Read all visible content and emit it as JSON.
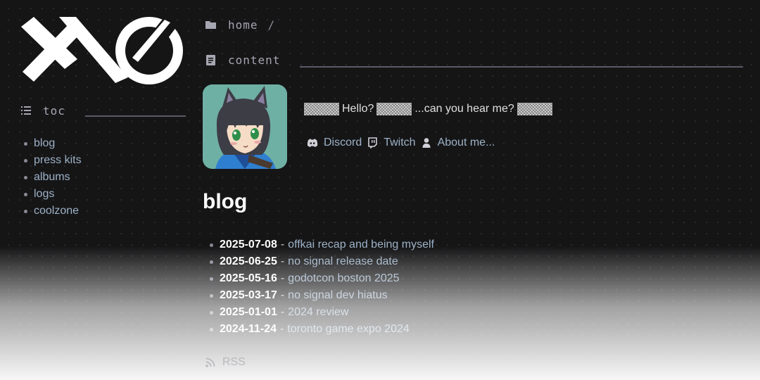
{
  "sidebar": {
    "toc_label": "toc",
    "items": [
      {
        "label": "blog"
      },
      {
        "label": "press kits"
      },
      {
        "label": "albums"
      },
      {
        "label": "logs"
      },
      {
        "label": "coolzone"
      }
    ]
  },
  "breadcrumb": {
    "home": "home",
    "separator": "/",
    "content": "content"
  },
  "profile": {
    "greeting_parts": [
      "Hello?",
      "...can you hear me?"
    ],
    "links": [
      {
        "label": "Discord",
        "icon": "discord-icon"
      },
      {
        "label": "Twitch",
        "icon": "twitch-icon"
      },
      {
        "label": "About me...",
        "icon": "person-icon"
      }
    ]
  },
  "blog": {
    "title": "blog",
    "posts": [
      {
        "date": "2025-07-08",
        "title": "offkai recap and being myself"
      },
      {
        "date": "2025-06-25",
        "title": "no signal release date"
      },
      {
        "date": "2025-05-16",
        "title": "godotcon boston 2025"
      },
      {
        "date": "2025-03-17",
        "title": "no signal dev hiatus"
      },
      {
        "date": "2025-01-01",
        "title": "2024 review"
      },
      {
        "date": "2024-11-24",
        "title": "toronto game expo 2024"
      }
    ],
    "rss_label": "RSS"
  },
  "colors": {
    "background": "#151516",
    "link": "#9db1c6",
    "heading": "#ffffff",
    "avatar_bg": "#6fb0a4"
  }
}
